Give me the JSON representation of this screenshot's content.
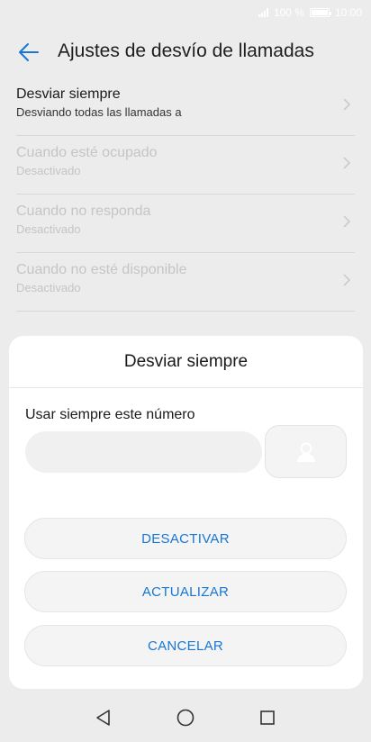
{
  "status_bar": {
    "battery_text": "100 %",
    "time": "10:00"
  },
  "header": {
    "title": "Ajustes de desvío de llamadas"
  },
  "forward_options": [
    {
      "title": "Desviar siempre",
      "subtitle": "Desviando todas las llamadas a",
      "enabled": true
    },
    {
      "title": "Cuando esté ocupado",
      "subtitle": "Desactivado",
      "enabled": false
    },
    {
      "title": "Cuando no responda",
      "subtitle": "Desactivado",
      "enabled": false
    },
    {
      "title": "Cuando no esté disponible",
      "subtitle": "Desactivado",
      "enabled": false
    }
  ],
  "dialog": {
    "title": "Desviar siempre",
    "field_label": "Usar siempre este número",
    "number_value": "",
    "number_placeholder": "",
    "buttons": {
      "disable": "DESACTIVAR",
      "update": "ACTUALIZAR",
      "cancel": "CANCELAR"
    }
  },
  "icons": {
    "back": "arrow-left-icon",
    "chevron": "chevron-right-icon",
    "contact": "contact-person-icon",
    "nav_back": "triangle-back-icon",
    "nav_home": "circle-home-icon",
    "nav_recent": "square-recents-icon"
  },
  "colors": {
    "accent": "#1677d4",
    "disabled_text": "#c5c5c5"
  }
}
